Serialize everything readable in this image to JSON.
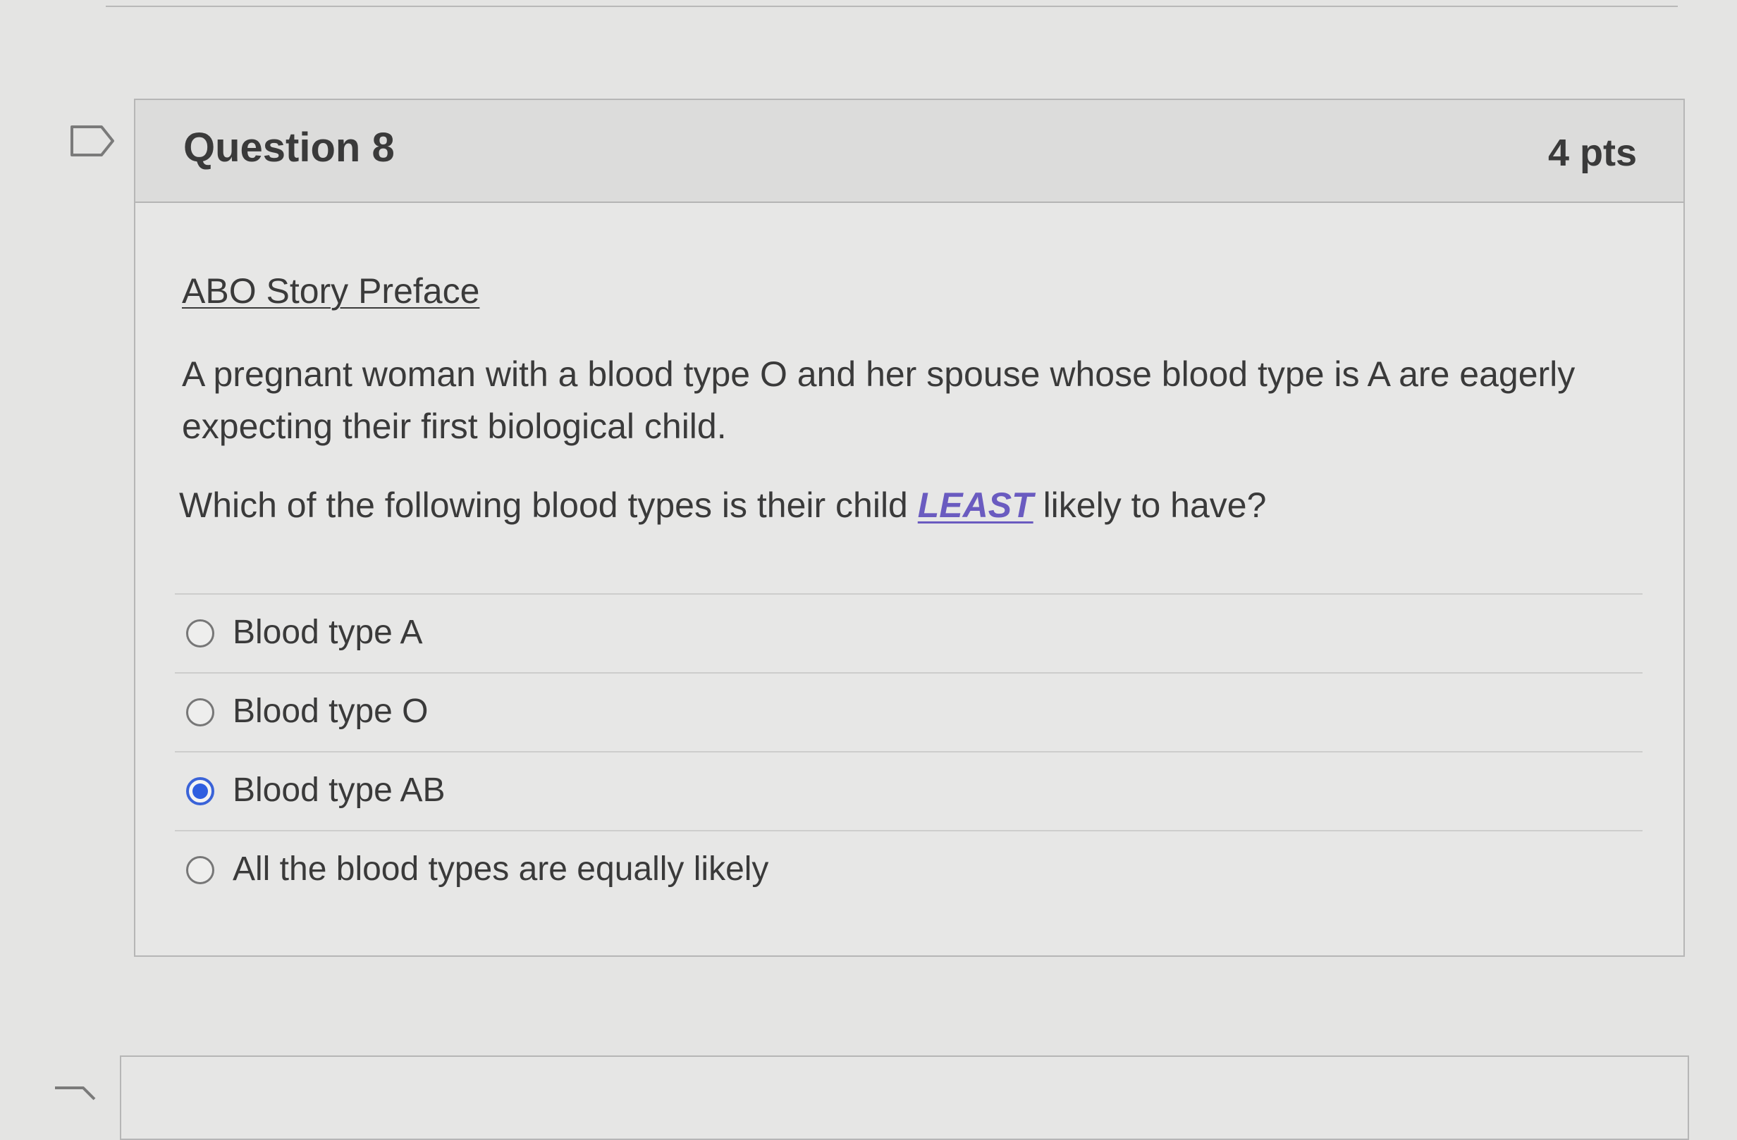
{
  "question": {
    "title": "Question 8",
    "points": "4 pts",
    "flag_icon": "flag-outline-icon",
    "preface_link": "ABO Story Preface",
    "story_text": "A pregnant woman with a blood type O and her spouse whose blood type is A are eagerly expecting their first biological child.",
    "prompt_before": "Which of the following blood types is their child ",
    "prompt_emphasis": "LEAST",
    "prompt_after": " likely to have?",
    "answers": [
      {
        "label": "Blood type A",
        "selected": false
      },
      {
        "label": "Blood type O",
        "selected": false
      },
      {
        "label": "Blood type AB",
        "selected": true
      },
      {
        "label": "All the blood types are equally likely",
        "selected": false
      }
    ]
  },
  "colors": {
    "selected_radio": "#2f5ee0",
    "emphasis_text": "#6a5bc0",
    "card_background": "#e7e7e6"
  }
}
